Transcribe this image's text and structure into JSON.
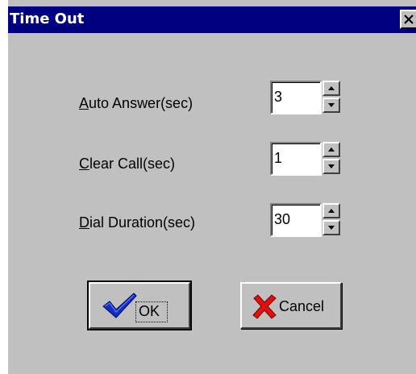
{
  "window": {
    "title": "Time Out"
  },
  "fields": [
    {
      "label": "Auto Answer(sec)",
      "mnemonic": "A",
      "rest": "uto Answer(sec)",
      "value": "3"
    },
    {
      "label": "Clear Call(sec)",
      "mnemonic": "C",
      "rest": "lear Call(sec)",
      "value": "1"
    },
    {
      "label": "Dial Duration(sec)",
      "mnemonic": "D",
      "rest": "ial Duration(sec)",
      "value": "30"
    }
  ],
  "buttons": {
    "ok_label": "OK",
    "cancel_label": "Cancel"
  },
  "icons": {
    "ok": "checkmark-icon",
    "cancel": "x-mark-icon"
  },
  "colors": {
    "titlebar": "#000080",
    "face": "#c0c0c0",
    "check": "#1030c0",
    "xmark": "#e01010"
  }
}
